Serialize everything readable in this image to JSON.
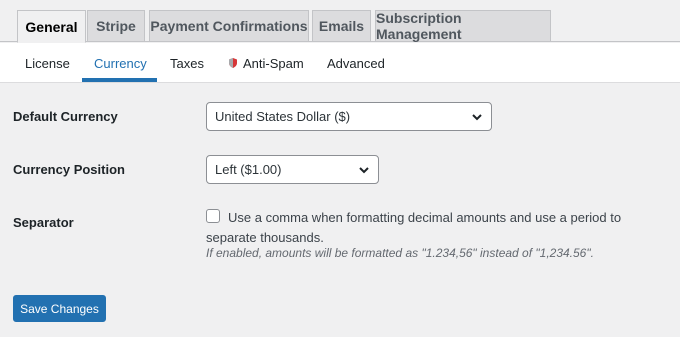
{
  "tabs": [
    "General",
    "Stripe",
    "Payment Confirmations",
    "Emails",
    "Subscription Management"
  ],
  "subtabs": [
    "License",
    "Currency",
    "Taxes",
    "Anti-Spam",
    "Advanced"
  ],
  "fields": {
    "default_currency": {
      "label": "Default Currency",
      "value": "United States Dollar ($)"
    },
    "currency_position": {
      "label": "Currency Position",
      "value": "Left ($1.00)"
    },
    "separator": {
      "label": "Separator",
      "checkbox_label": "Use a comma when formatting decimal amounts and use a period to separate thousands.",
      "checked": false,
      "description": "If enabled, amounts will be formatted as \"1.234,56\" instead of \"1,234.56\"."
    }
  },
  "save_label": "Save Changes",
  "colors": {
    "accent": "#2271b1",
    "background": "#f0f0f1",
    "shield": "#d63638"
  }
}
